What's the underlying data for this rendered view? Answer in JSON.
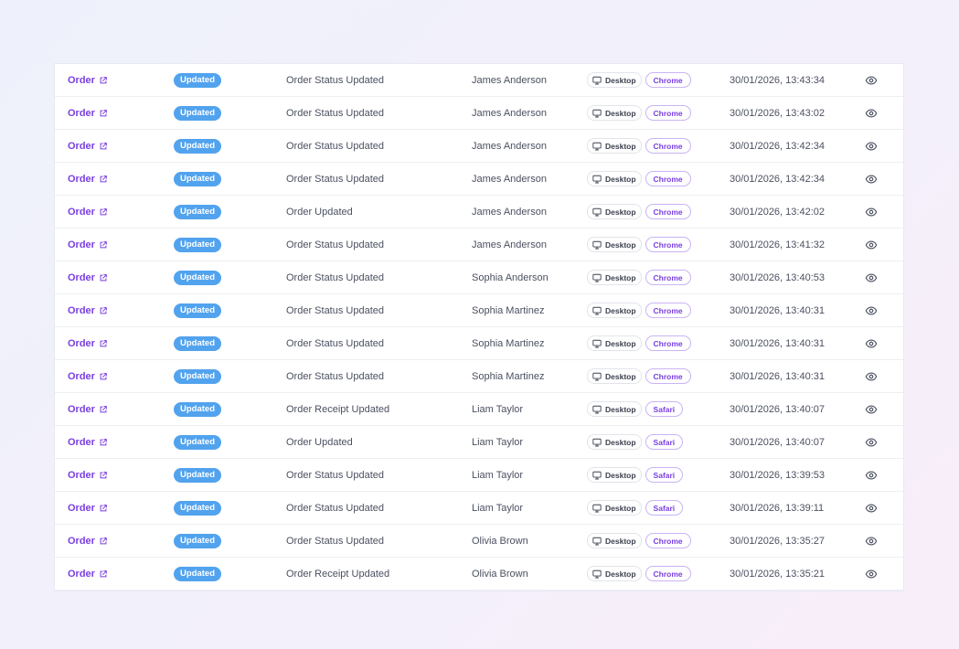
{
  "colors": {
    "link": "#7a3fe0",
    "badge_bg": "#52a3ee",
    "browser_border": "#c9b4f3"
  },
  "icons": {
    "link_icon": "external-link-icon",
    "device_icon": "monitor-icon",
    "view_icon": "eye-icon"
  },
  "rows": [
    {
      "link": "Order",
      "badge": "Updated",
      "event": "Order Status Updated",
      "user": "James Anderson",
      "device": "Desktop",
      "browser": "Chrome",
      "time": "30/01/2026, 13:43:34"
    },
    {
      "link": "Order",
      "badge": "Updated",
      "event": "Order Status Updated",
      "user": "James Anderson",
      "device": "Desktop",
      "browser": "Chrome",
      "time": "30/01/2026, 13:43:02"
    },
    {
      "link": "Order",
      "badge": "Updated",
      "event": "Order Status Updated",
      "user": "James Anderson",
      "device": "Desktop",
      "browser": "Chrome",
      "time": "30/01/2026, 13:42:34"
    },
    {
      "link": "Order",
      "badge": "Updated",
      "event": "Order Status Updated",
      "user": "James Anderson",
      "device": "Desktop",
      "browser": "Chrome",
      "time": "30/01/2026, 13:42:34"
    },
    {
      "link": "Order",
      "badge": "Updated",
      "event": "Order Updated",
      "user": "James Anderson",
      "device": "Desktop",
      "browser": "Chrome",
      "time": "30/01/2026, 13:42:02"
    },
    {
      "link": "Order",
      "badge": "Updated",
      "event": "Order Status Updated",
      "user": "James Anderson",
      "device": "Desktop",
      "browser": "Chrome",
      "time": "30/01/2026, 13:41:32"
    },
    {
      "link": "Order",
      "badge": "Updated",
      "event": "Order Status Updated",
      "user": "Sophia Anderson",
      "device": "Desktop",
      "browser": "Chrome",
      "time": "30/01/2026, 13:40:53"
    },
    {
      "link": "Order",
      "badge": "Updated",
      "event": "Order Status Updated",
      "user": "Sophia Martinez",
      "device": "Desktop",
      "browser": "Chrome",
      "time": "30/01/2026, 13:40:31"
    },
    {
      "link": "Order",
      "badge": "Updated",
      "event": "Order Status Updated",
      "user": "Sophia Martinez",
      "device": "Desktop",
      "browser": "Chrome",
      "time": "30/01/2026, 13:40:31"
    },
    {
      "link": "Order",
      "badge": "Updated",
      "event": "Order Status Updated",
      "user": "Sophia Martinez",
      "device": "Desktop",
      "browser": "Chrome",
      "time": "30/01/2026, 13:40:31"
    },
    {
      "link": "Order",
      "badge": "Updated",
      "event": "Order Receipt Updated",
      "user": "Liam Taylor",
      "device": "Desktop",
      "browser": "Safari",
      "time": "30/01/2026, 13:40:07"
    },
    {
      "link": "Order",
      "badge": "Updated",
      "event": "Order Updated",
      "user": "Liam Taylor",
      "device": "Desktop",
      "browser": "Safari",
      "time": "30/01/2026, 13:40:07"
    },
    {
      "link": "Order",
      "badge": "Updated",
      "event": "Order Status Updated",
      "user": "Liam Taylor",
      "device": "Desktop",
      "browser": "Safari",
      "time": "30/01/2026, 13:39:53"
    },
    {
      "link": "Order",
      "badge": "Updated",
      "event": "Order Status Updated",
      "user": "Liam Taylor",
      "device": "Desktop",
      "browser": "Safari",
      "time": "30/01/2026, 13:39:11"
    },
    {
      "link": "Order",
      "badge": "Updated",
      "event": "Order Status Updated",
      "user": "Olivia Brown",
      "device": "Desktop",
      "browser": "Chrome",
      "time": "30/01/2026, 13:35:27"
    },
    {
      "link": "Order",
      "badge": "Updated",
      "event": "Order Receipt Updated",
      "user": "Olivia Brown",
      "device": "Desktop",
      "browser": "Chrome",
      "time": "30/01/2026, 13:35:21"
    }
  ]
}
